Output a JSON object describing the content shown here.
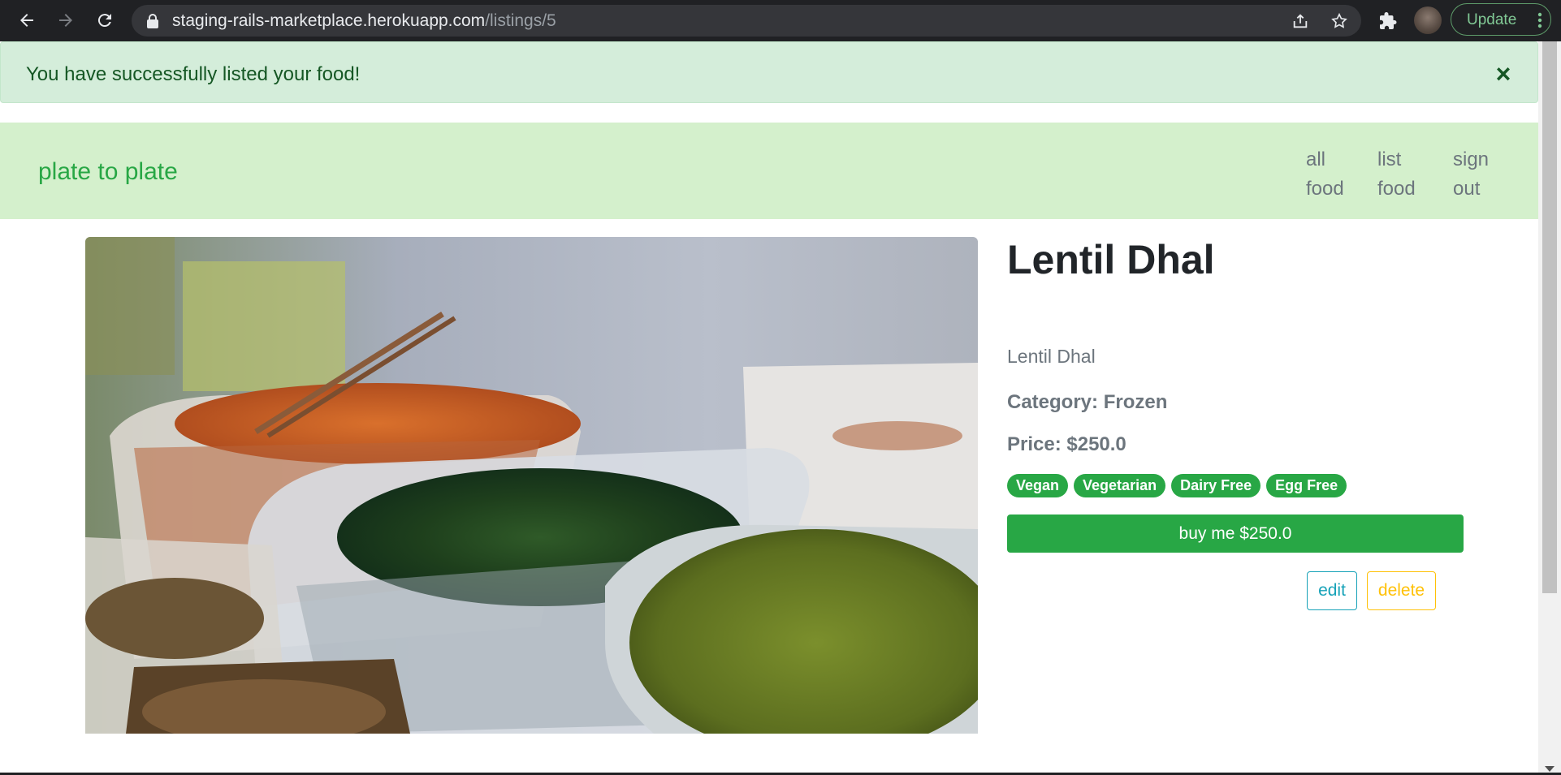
{
  "browser": {
    "url_host": "staging-rails-marketplace.herokuapp.com",
    "url_path": "/listings/5",
    "update_label": "Update"
  },
  "alert": {
    "message": "You have successfully listed your food!",
    "close_label": "×"
  },
  "navbar": {
    "brand": "plate to plate",
    "links": [
      {
        "line1": "all",
        "line2": "food"
      },
      {
        "line1": "list",
        "line2": "food"
      },
      {
        "line1": "sign",
        "line2": "out"
      }
    ]
  },
  "listing": {
    "title": "Lentil Dhal",
    "description": "Lentil Dhal",
    "category": "Category: Frozen",
    "price": "Price: $250.0",
    "tags": [
      "Vegan",
      "Vegetarian",
      "Dairy Free",
      "Egg Free"
    ],
    "buy_label": "buy me $250.0",
    "edit_label": "edit",
    "delete_label": "delete"
  },
  "colors": {
    "brand_green": "#28a745",
    "alert_bg": "#d4edda",
    "navbar_bg": "#d4f0cc",
    "edit_color": "#17a2b8",
    "delete_color": "#ffc107"
  }
}
